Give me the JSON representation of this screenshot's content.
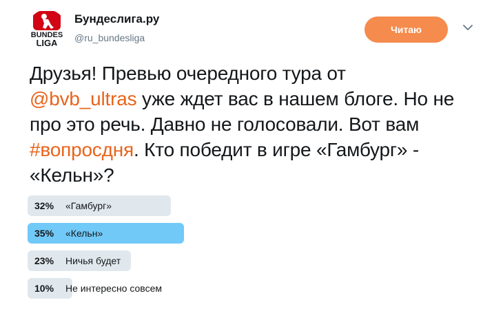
{
  "account": {
    "name": "Бундеслига.ру",
    "handle": "@ru_bundesliga",
    "logo_text_top": "BUNDES",
    "logo_text_bottom": "LIGA"
  },
  "follow_button": {
    "label": "Читаю",
    "color": "#f58b4c"
  },
  "tweet": {
    "p1": "Друзья! Превью очередного тура  от",
    "mention": "@bvb_ultras",
    "p2": " уже ждет вас в нашем блоге. Но не про это речь. Давно не голосовали. Вот вам ",
    "hashtag": "#вопросдня",
    "p3": ". Кто победит в игре «Гамбург» - «Кельн»?"
  },
  "poll": {
    "options": [
      {
        "pct": "32%",
        "label": "«Гамбург»",
        "share": 0.32,
        "winner": false
      },
      {
        "pct": "35%",
        "label": "«Кельн»",
        "share": 0.35,
        "winner": true
      },
      {
        "pct": "23%",
        "label": "Ничья будет",
        "share": 0.23,
        "winner": false
      },
      {
        "pct": "10%",
        "label": "Не интересно совсем",
        "share": 0.1,
        "winner": false
      }
    ]
  },
  "colors": {
    "link": "#e8641b",
    "bar": "#e1e8ed",
    "bar_winner": "#71c9f8"
  }
}
